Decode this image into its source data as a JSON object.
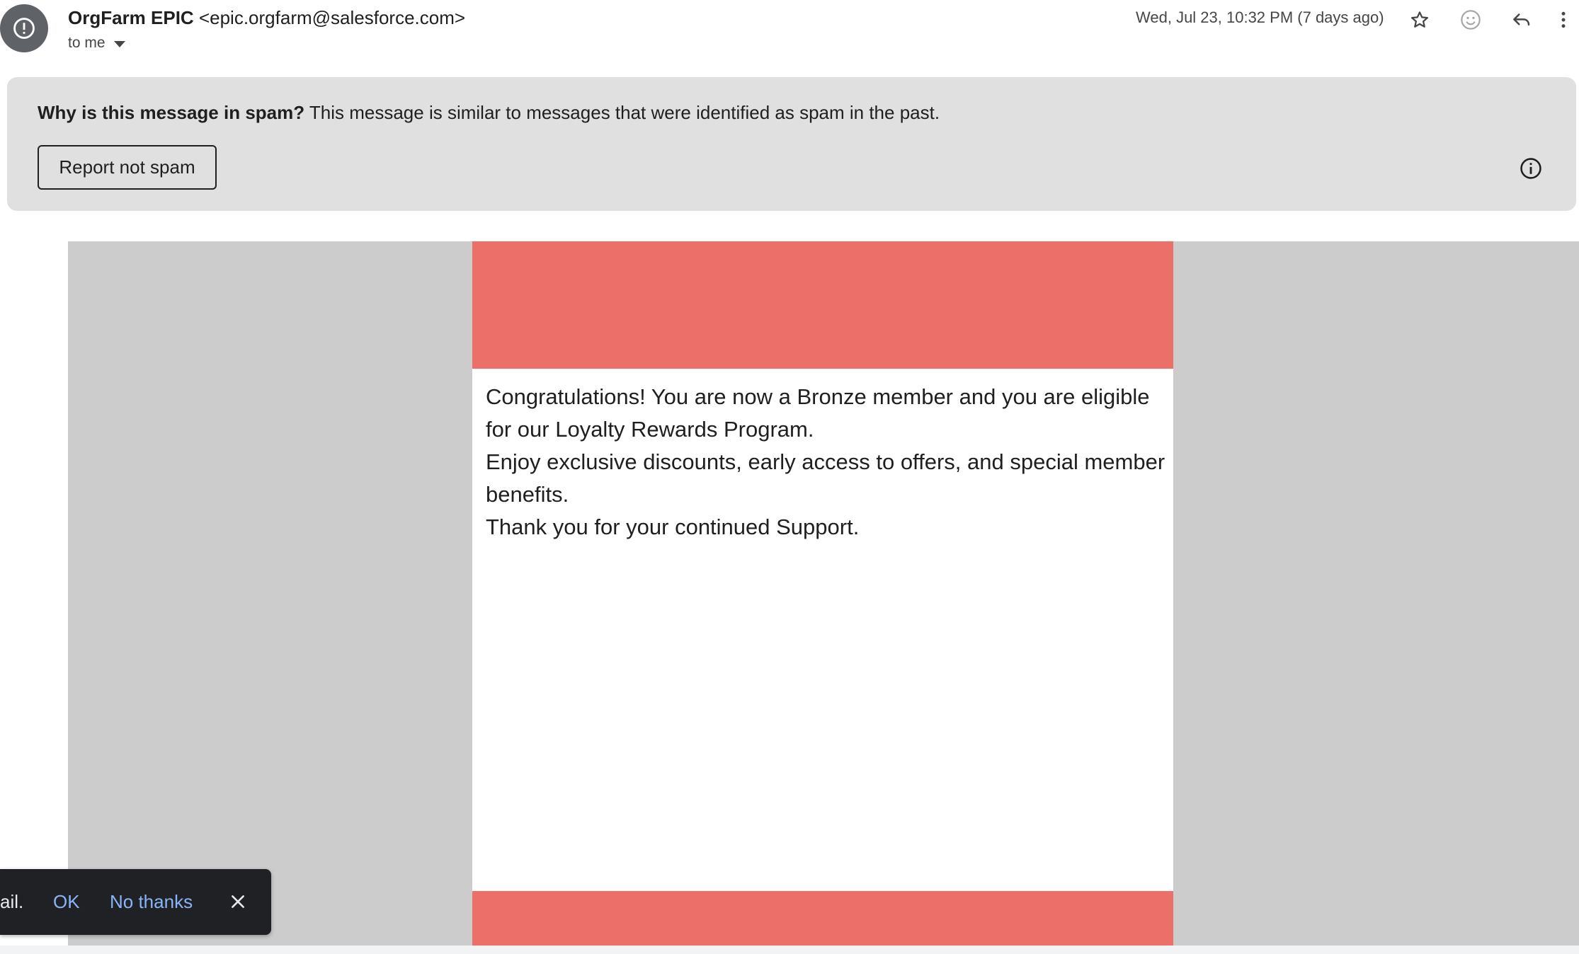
{
  "header": {
    "avatar_icon": "spam-warning-icon",
    "sender_name": "OrgFarm EPIC",
    "sender_email": "<epic.orgfarm@salesforce.com>",
    "recipient_label": "to me",
    "date": "Wed, Jul 23, 10:32 PM (7 days ago)",
    "icons": [
      "star-icon",
      "emoji-reaction-icon",
      "reply-icon",
      "more-options-icon"
    ]
  },
  "spam_banner": {
    "title": "Why is this message in spam?",
    "message": "This message is similar to messages that were identified as spam in the past.",
    "button_label": "Report not spam",
    "icon": "info-icon"
  },
  "email_body": {
    "accent_color": "#ed6f6a",
    "paragraphs": [
      "Congratulations! You are now a Bronze member and you are eligible for our Loyalty Rewards Program.",
      "Enjoy exclusive discounts, early access to offers, and special member benefits.",
      "Thank you for your continued Support."
    ]
  },
  "snackbar": {
    "text": "ail.",
    "ok_label": "OK",
    "no_thanks_label": "No thanks",
    "close_icon": "close-icon"
  }
}
